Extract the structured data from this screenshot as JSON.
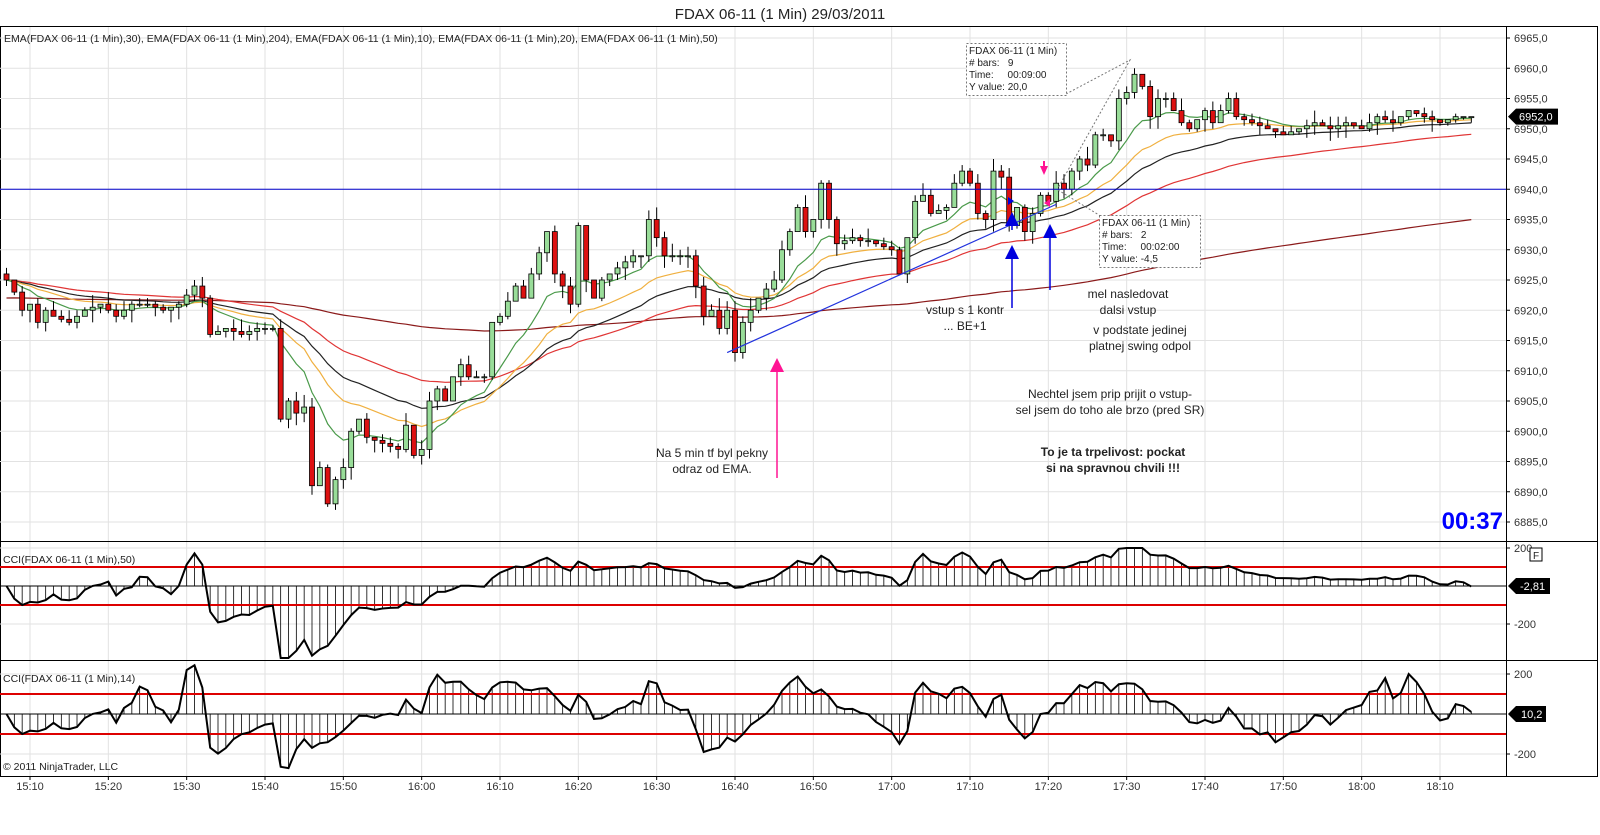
{
  "title": "FDAX 06-11 (1 Min)  29/03/2011",
  "legend": "EMA(FDAX 06-11 (1 Min),30), EMA(FDAX 06-11 (1 Min),204), EMA(FDAX 06-11 (1 Min),10), EMA(FDAX 06-11 (1 Min),20), EMA(FDAX 06-11 (1 Min),50)",
  "timer": "00:37",
  "copyright": "© 2011 NinjaTrader, LLC",
  "last_price_tag": "6952,0",
  "cci50_tag": "-2,81",
  "cci14_tag": "10,2",
  "cci50_label": "CCI(FDAX 06-11 (1 Min),50)",
  "cci14_label": "CCI(FDAX 06-11 (1 Min),14)",
  "f_button": "F",
  "colors": {
    "up": "#99dd99",
    "down": "#dd1111",
    "ema10": "#4a9a4a",
    "ema20": "#f0b040",
    "ema30": "#222222",
    "ema50": "#e03535",
    "ema204": "#8b1a1a",
    "hline": "#0000cc",
    "trend": "#2233dd",
    "pink": "#ff1493",
    "blue": "#0000dd",
    "timer": "#0000ff"
  },
  "rulers": [
    {
      "lines": [
        "FDAX 06-11 (1 Min)",
        "# bars:   9",
        "Time:     00:09:00",
        "Y value: 20,0"
      ]
    },
    {
      "lines": [
        "FDAX 06-11 (1 Min)",
        "# bars:   2",
        "Time:     00:02:00",
        "Y value: -4,5"
      ]
    }
  ],
  "notes": {
    "n1": [
      "vstup s 1 kontr",
      "... BE+1"
    ],
    "n2": [
      "mel nasledovat",
      "dalsi vstup"
    ],
    "n3": [
      "v podstate jedinej",
      "platnej swing odpol"
    ],
    "n4": [
      "Nechtel jsem prip prijit o vstup-",
      "sel jsem do toho ale brzo (pred SR)"
    ],
    "n5": [
      "To je ta trpelivost: pockat",
      "si na spravnou chvili !!!"
    ],
    "n6": [
      "Na 5 min tf byl pekny",
      "odraz od EMA."
    ]
  },
  "chart_data": {
    "type": "candlestick",
    "instrument": "FDAX 06-11 (1 Min)",
    "date": "29/03/2011",
    "ylim": [
      6883,
      6966
    ],
    "yticks": [
      "6965,0",
      "6960,0",
      "6955,0",
      "6950,0",
      "6945,0",
      "6940,0",
      "6935,0",
      "6930,0",
      "6925,0",
      "6920,0",
      "6915,0",
      "6910,0",
      "6905,0",
      "6900,0",
      "6895,0",
      "6890,0",
      "6885,0"
    ],
    "xticks": [
      "15:10",
      "15:20",
      "15:30",
      "15:40",
      "15:50",
      "16:00",
      "16:10",
      "16:20",
      "16:30",
      "16:40",
      "16:50",
      "17:00",
      "17:10",
      "17:20",
      "17:30",
      "17:40",
      "17:50",
      "18:00",
      "18:10"
    ],
    "close_anchors": [
      [
        "15:07",
        6925
      ],
      [
        "15:08",
        6923
      ],
      [
        "15:09",
        6920
      ],
      [
        "15:10",
        6921
      ],
      [
        "15:11",
        6918
      ],
      [
        "15:12",
        6920
      ],
      [
        "15:13",
        6919
      ],
      [
        "15:15",
        6918
      ],
      [
        "15:17",
        6920
      ],
      [
        "15:19",
        6921
      ],
      [
        "15:21",
        6919
      ],
      [
        "15:23",
        6921
      ],
      [
        "15:25",
        6921
      ],
      [
        "15:27",
        6920
      ],
      [
        "15:29",
        6921
      ],
      [
        "15:31",
        6924
      ],
      [
        "15:32",
        6922
      ],
      [
        "15:33",
        6916
      ],
      [
        "15:35",
        6917
      ],
      [
        "15:37",
        6916
      ],
      [
        "15:39",
        6917
      ],
      [
        "15:41",
        6917
      ],
      [
        "15:42",
        6902
      ],
      [
        "15:43",
        6905
      ],
      [
        "15:44",
        6903
      ],
      [
        "15:45",
        6904
      ],
      [
        "15:46",
        6891
      ],
      [
        "15:47",
        6894
      ],
      [
        "15:48",
        6888
      ],
      [
        "15:49",
        6892
      ],
      [
        "15:50",
        6894
      ],
      [
        "15:51",
        6900
      ],
      [
        "15:52",
        6902
      ],
      [
        "15:53",
        6899
      ],
      [
        "15:55",
        6898
      ],
      [
        "15:57",
        6897
      ],
      [
        "15:58",
        6901
      ],
      [
        "15:59",
        6896
      ],
      [
        "16:00",
        6897
      ],
      [
        "16:01",
        6905
      ],
      [
        "16:02",
        6907
      ],
      [
        "16:03",
        6905
      ],
      [
        "16:04",
        6909
      ],
      [
        "16:05",
        6911
      ],
      [
        "16:06",
        6909
      ],
      [
        "16:08",
        6909
      ],
      [
        "16:09",
        6918
      ],
      [
        "16:10",
        6919
      ],
      [
        "16:12",
        6924
      ],
      [
        "16:13",
        6922
      ],
      [
        "16:14",
        6926
      ],
      [
        "16:16",
        6933
      ],
      [
        "16:17",
        6926
      ],
      [
        "16:18",
        6924
      ],
      [
        "16:19",
        6921
      ],
      [
        "16:20",
        6934
      ],
      [
        "16:21",
        6925
      ],
      [
        "16:22",
        6922
      ],
      [
        "16:23",
        6925
      ],
      [
        "16:25",
        6927
      ],
      [
        "16:27",
        6929
      ],
      [
        "16:28",
        6929
      ],
      [
        "16:29",
        6935
      ],
      [
        "16:30",
        6932
      ],
      [
        "16:31",
        6929
      ],
      [
        "16:34",
        6929
      ],
      [
        "16:35",
        6924
      ],
      [
        "16:36",
        6919
      ],
      [
        "16:37",
        6920
      ],
      [
        "16:38",
        6917
      ],
      [
        "16:39",
        6920
      ],
      [
        "16:40",
        6913
      ],
      [
        "16:41",
        6918
      ],
      [
        "16:42",
        6920
      ],
      [
        "16:43",
        6922
      ],
      [
        "16:45",
        6925
      ],
      [
        "16:46",
        6930
      ],
      [
        "16:47",
        6933
      ],
      [
        "16:48",
        6937
      ],
      [
        "16:49",
        6933
      ],
      [
        "16:50",
        6935
      ],
      [
        "16:51",
        6941
      ],
      [
        "16:52",
        6935
      ],
      [
        "16:53",
        6931
      ],
      [
        "16:55",
        6932
      ],
      [
        "16:58",
        6931
      ],
      [
        "17:00",
        6930
      ],
      [
        "17:01",
        6926
      ],
      [
        "17:02",
        6932
      ],
      [
        "17:03",
        6938
      ],
      [
        "17:04",
        6939
      ],
      [
        "17:05",
        6936
      ],
      [
        "17:07",
        6937
      ],
      [
        "17:08",
        6941
      ],
      [
        "17:09",
        6943
      ],
      [
        "17:10",
        6941
      ],
      [
        "17:11",
        6936
      ],
      [
        "17:12",
        6935
      ],
      [
        "17:13",
        6943
      ],
      [
        "17:14",
        6942
      ],
      [
        "17:15",
        6934
      ],
      [
        "17:16",
        6937
      ],
      [
        "17:17",
        6933
      ],
      [
        "17:18",
        6936
      ],
      [
        "17:19",
        6939
      ],
      [
        "17:20",
        6938
      ],
      [
        "17:21",
        6941
      ],
      [
        "17:22",
        6940
      ],
      [
        "17:23",
        6943
      ],
      [
        "17:24",
        6945
      ],
      [
        "17:25",
        6944
      ],
      [
        "17:26",
        6949
      ],
      [
        "17:27",
        6949
      ],
      [
        "17:28",
        6948
      ],
      [
        "17:29",
        6955
      ],
      [
        "17:30",
        6956
      ],
      [
        "17:31",
        6959
      ],
      [
        "17:32",
        6957
      ],
      [
        "17:33",
        6952
      ],
      [
        "17:34",
        6955
      ],
      [
        "17:35",
        6955
      ],
      [
        "17:36",
        6953
      ],
      [
        "17:37",
        6951
      ],
      [
        "17:38",
        6950
      ],
      [
        "17:40",
        6953
      ],
      [
        "17:41",
        6951
      ],
      [
        "17:42",
        6953
      ],
      [
        "17:43",
        6955
      ],
      [
        "17:44",
        6952
      ],
      [
        "17:46",
        6951
      ],
      [
        "17:48",
        6950
      ],
      [
        "17:50",
        6949
      ],
      [
        "17:52",
        6950
      ],
      [
        "17:54",
        6951
      ],
      [
        "17:56",
        6950
      ],
      [
        "17:58",
        6951
      ],
      [
        "18:00",
        6950
      ],
      [
        "18:02",
        6952
      ],
      [
        "18:04",
        6951
      ],
      [
        "18:06",
        6953
      ],
      [
        "18:08",
        6952
      ],
      [
        "18:10",
        6951
      ],
      [
        "18:12",
        6952
      ],
      [
        "18:14",
        6952
      ]
    ],
    "ema_periods": [
      10,
      20,
      30,
      50,
      204
    ],
    "horizontal_line": 6940,
    "trendline": [
      [
        "16:39",
        6913
      ],
      [
        "17:21",
        6937.5
      ]
    ],
    "cci_panels": [
      {
        "period": 50,
        "yticks": [
          "200",
          "-200"
        ],
        "levels": [
          100,
          -100
        ],
        "last": -2.81
      },
      {
        "period": 14,
        "yticks": [
          "200",
          "-200"
        ],
        "levels": [
          100,
          -100
        ],
        "last": 10.2
      }
    ]
  }
}
